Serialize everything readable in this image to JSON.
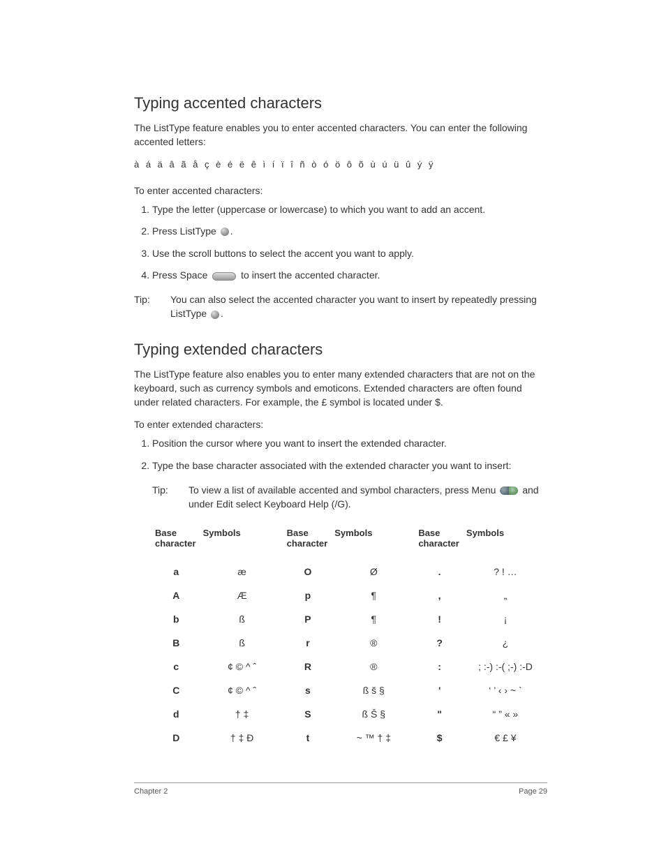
{
  "section1": {
    "heading": "Typing accented characters",
    "intro": "The ListType feature enables you to enter accented characters. You can enter the following accented letters:",
    "accented_line": "à á ä â ã å ç è é ë ê ì í ï î ñ ò ó ö ô õ ù ú ü û ý ÿ",
    "subheading": "To enter accented characters:",
    "steps": {
      "s1": "Type the letter (uppercase or lowercase) to which you want to add an accent.",
      "s2a": "Press ListType ",
      "s2b": ".",
      "s3": "Use the scroll buttons to select the accent you want to apply.",
      "s4a": "Press Space ",
      "s4b": " to insert the accented character."
    },
    "tip": {
      "label": "Tip:",
      "body_a": "You can also select the accented character you want to insert by repeatedly pressing ListType ",
      "body_b": "."
    }
  },
  "section2": {
    "heading": "Typing extended characters",
    "intro": "The ListType feature also enables you to enter many extended characters that are not on the keyboard, such as currency symbols and emoticons. Extended characters are often found under related characters. For example, the £ symbol is located under $.",
    "subheading": "To enter extended characters:",
    "steps": {
      "s1": "Position the cursor where you want to insert the extended character.",
      "s2": "Type the base character associated with the extended character you want to insert:"
    },
    "tip": {
      "label": "Tip:",
      "body_a": "To view a list of available accented and symbol characters, press Menu ",
      "body_b": " and under Edit select Keyboard Help (/G)."
    }
  },
  "table": {
    "headers": {
      "base": "Base character",
      "symbols": "Symbols"
    },
    "rows": [
      {
        "b1": "a",
        "s1": "æ",
        "b2": "O",
        "s2": "Ø",
        "b3": ".",
        "s3": "? ! …"
      },
      {
        "b1": "A",
        "s1": "Æ",
        "b2": "p",
        "s2": "¶",
        "b3": ",",
        "s3": "„"
      },
      {
        "b1": "b",
        "s1": "ß",
        "b2": "P",
        "s2": "¶",
        "b3": "!",
        "s3": "¡"
      },
      {
        "b1": "B",
        "s1": "ß",
        "b2": "r",
        "s2": "®",
        "b3": "?",
        "s3": "¿"
      },
      {
        "b1": "c",
        "s1": "¢ © ^ ˆ",
        "b2": "R",
        "s2": "®",
        "b3": ":",
        "s3": "; :-)  :-(  ;-)  :-D"
      },
      {
        "b1": "C",
        "s1": "¢ © ^ ˆ",
        "b2": "s",
        "s2": "ß š §",
        "b3": "'",
        "s3": "‘ ’ ‹ › ~ `"
      },
      {
        "b1": "d",
        "s1": "† ‡",
        "b2": "S",
        "s2": "ß Š §",
        "b3": "\"",
        "s3": "“ ” « »"
      },
      {
        "b1": "D",
        "s1": "† ‡ Ð",
        "b2": "t",
        "s2": "~ ™ † ‡",
        "b3": "$",
        "s3": "€ £ ¥"
      }
    ]
  },
  "footer": {
    "left": "Chapter 2",
    "right": "Page 29"
  }
}
